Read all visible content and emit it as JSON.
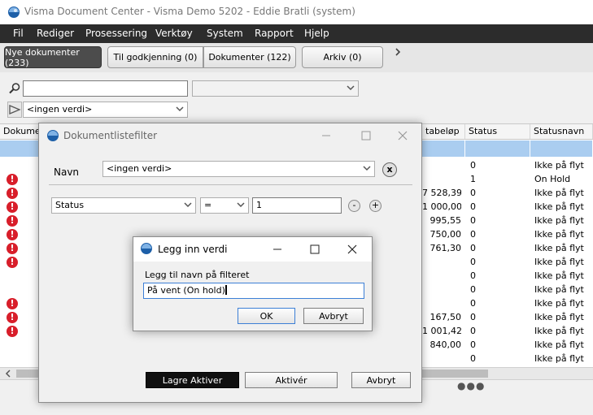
{
  "window": {
    "title": "Visma Document Center - Visma Demo 5202 - Eddie Bratli (system)"
  },
  "menu": [
    "Fil",
    "Rediger",
    "Prosessering",
    "Verktøy",
    "System",
    "Rapport",
    "Hjelp"
  ],
  "tabs": [
    {
      "label": "Nye dokumenter (233)",
      "active": true
    },
    {
      "label": "Til godkjenning (0)",
      "active": false
    },
    {
      "label": "Dokumenter (122)",
      "active": false
    },
    {
      "label": "Arkiv (0)",
      "active": false
    }
  ],
  "filterbar": {
    "search_value": "",
    "second_select": "",
    "filter_select": "<ingen verdi>"
  },
  "grid": {
    "headers": [
      "Dokumen",
      "tabeløp",
      "Status",
      "Statusnavn"
    ],
    "rows": [
      {
        "error": false,
        "amount": "",
        "status": "0",
        "name": "Ikke på flyt"
      },
      {
        "error": true,
        "amount": "",
        "status": "1",
        "name": "On Hold"
      },
      {
        "error": true,
        "amount": "7 528,39",
        "status": "0",
        "name": "Ikke på flyt"
      },
      {
        "error": true,
        "amount": "1 000,00",
        "status": "0",
        "name": "Ikke på flyt"
      },
      {
        "error": true,
        "amount": "995,55",
        "status": "0",
        "name": "Ikke på flyt"
      },
      {
        "error": true,
        "amount": "750,00",
        "status": "0",
        "name": "Ikke på flyt"
      },
      {
        "error": true,
        "amount": "761,30",
        "status": "0",
        "name": "Ikke på flyt"
      },
      {
        "error": true,
        "amount": "",
        "status": "0",
        "name": "Ikke på flyt"
      },
      {
        "error": false,
        "amount": "",
        "status": "0",
        "name": "Ikke på flyt"
      },
      {
        "error": false,
        "amount": "",
        "status": "0",
        "name": "Ikke på flyt"
      },
      {
        "error": true,
        "amount": "",
        "status": "0",
        "name": "Ikke på flyt"
      },
      {
        "error": true,
        "amount": "167,50",
        "status": "0",
        "name": "Ikke på flyt"
      },
      {
        "error": true,
        "amount": "1 001,42",
        "status": "0",
        "name": "Ikke på flyt"
      },
      {
        "error": false,
        "amount": "840,00",
        "status": "0",
        "name": "Ikke på flyt"
      },
      {
        "error": false,
        "amount": "",
        "status": "0",
        "name": "Ikke på flyt"
      }
    ]
  },
  "filter_dialog": {
    "title": "Dokumentlistefilter",
    "name_label": "Navn",
    "name_value": "<ingen verdi>",
    "field_value": "Status",
    "operator_value": "=",
    "compare_value": "1",
    "remove_label": "-",
    "add_label": "+",
    "clear_label": "x",
    "save_activate_label": "Lagre  Aktiver",
    "activate_label": "Aktivér",
    "cancel_label": "Avbryt"
  },
  "value_dialog": {
    "title": "Legg inn verdi",
    "prompt": "Legg til navn på filteret",
    "value": "På vent (On hold)",
    "ok_label": "OK",
    "cancel_label": "Avbryt"
  },
  "colors": {
    "menubar": "#2c2c2c",
    "error": "#d81e2a",
    "selection": "#aacdf0"
  }
}
